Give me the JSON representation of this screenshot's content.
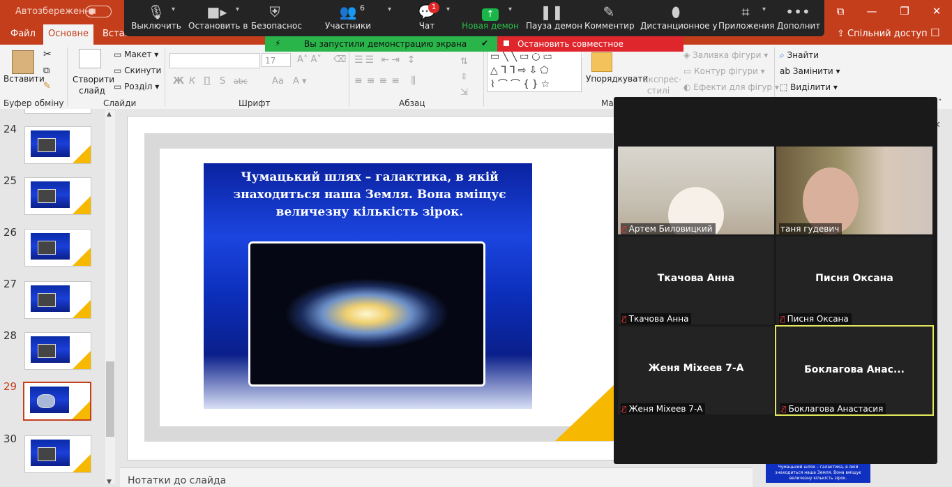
{
  "titlebar": {
    "autosave": "Автозбереження",
    "min": "—",
    "max": "❐",
    "close": "✕",
    "ribbon_toggle": "⧉"
  },
  "tabs": {
    "file": "Файл",
    "home": "Основне",
    "insert": "Вставл",
    "share": "Спільний доступ"
  },
  "ribbon": {
    "paste": "Вставити",
    "clipboard": "Буфер обміну",
    "new_slide": "Створити слайд",
    "layout": "Макет",
    "reset": "Скинути",
    "section": "Розділ",
    "slides": "Слайди",
    "font_size": "17",
    "font_group": "Шрифт",
    "bold": "Ж",
    "italic": "К",
    "underline": "П",
    "strike": "S",
    "abc": "abc",
    "aa": "Aa",
    "paragraph": "Абзац",
    "arrange": "Упорядкувати",
    "express_styles": "Експрес-стилі",
    "fill": "Заливка фігури",
    "outline": "Контур фігури",
    "effects": "Ефекти для фігур",
    "drawing_prefix": "Мал",
    "find": "Знайти",
    "replace": "Замінити",
    "select": "Виділити"
  },
  "zoom": {
    "mute": "Выключить",
    "video": "Остановить в",
    "security": "Безопаснос",
    "participants": "Участники",
    "participants_count": "6",
    "chat": "Чат",
    "chat_badge": "1",
    "share": "Новая демон",
    "pause": "Пауза демон",
    "annotate": "Комментир",
    "remote": "Дистанционное у",
    "apps": "Приложения",
    "more": "Дополнит"
  },
  "banners": {
    "sharing": "Вы запустили демонстрацию экрана",
    "stop": "Остановить совместное использование"
  },
  "slides": {
    "numbers": [
      "24",
      "25",
      "26",
      "27",
      "28",
      "29",
      "30"
    ],
    "selected": "29"
  },
  "slide": {
    "text": "Чумацький шлях – галактика, в якій знаходиться наша Земля. Вона вміщує величезну кількість зірок."
  },
  "notes": "Нотатки до слайда",
  "minithumb": "Чумацький шлях – галактика, в якій знаходиться наша Земля. Вона вміщує величезну кількість зірок.",
  "gallery": [
    {
      "name": "",
      "label": "Артем Биловицкий"
    },
    {
      "name": "",
      "label": "таня гудевич"
    },
    {
      "name": "Ткачова Анна",
      "label": "Ткачова Анна"
    },
    {
      "name": "Писня Оксана",
      "label": "Писня Оксана"
    },
    {
      "name": "Женя Міхеев 7-А",
      "label": "Женя Міхеев 7-А"
    },
    {
      "name": "Боклагова  Анас...",
      "label": "Боклагова Анастасия"
    }
  ]
}
